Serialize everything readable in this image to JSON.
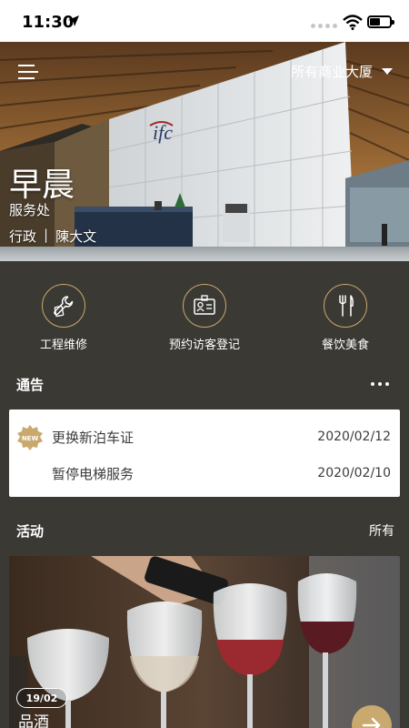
{
  "status_bar": {
    "time": "11:30"
  },
  "header": {
    "building_selector": "所有商业大厦",
    "greeting": "早晨",
    "department": "服务处",
    "role": "行政",
    "divider": "|",
    "user_name": "陳大文",
    "hero_sign": "ifc"
  },
  "services": [
    {
      "label": "工程维修",
      "icon": "wrench-icon"
    },
    {
      "label": "预约访客登记",
      "icon": "visitor-id-card-icon"
    },
    {
      "label": "餐饮美食",
      "icon": "fork-knife-icon"
    }
  ],
  "notices": {
    "title": "通告",
    "items": [
      {
        "title": "更换新泊车证",
        "date": "2020/02/12",
        "badge": "NEW"
      },
      {
        "title": "暂停电梯服务",
        "date": "2020/02/10"
      }
    ]
  },
  "activities": {
    "title": "活动",
    "all_label": "所有",
    "items": [
      {
        "date": "19/02",
        "title": "品酒"
      }
    ]
  },
  "colors": {
    "background": "#3b3934",
    "accent_gold": "#c9a96e",
    "card": "#ffffff"
  }
}
